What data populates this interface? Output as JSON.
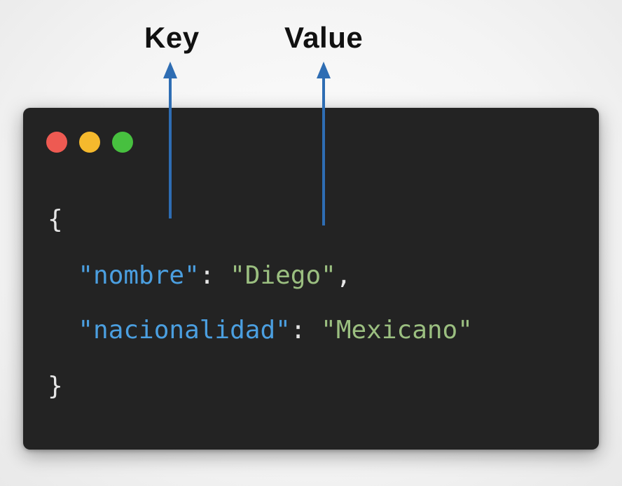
{
  "labels": {
    "key": "Key",
    "value": "Value"
  },
  "window_controls": [
    {
      "name": "close",
      "color": "#ee5a52"
    },
    {
      "name": "minimize",
      "color": "#f5b92d"
    },
    {
      "name": "zoom",
      "color": "#47c03f"
    }
  ],
  "colors": {
    "key_string": "#4b9fe0",
    "value_string": "#9bbf80",
    "punctuation": "#e6e6e6",
    "arrow": "#2e6db3",
    "window_bg": "#232323"
  },
  "code": {
    "open_brace": "{",
    "close_brace": "}",
    "entries": [
      {
        "key": "\"nombre\"",
        "colon": ": ",
        "value": "\"Diego\"",
        "trailing": ","
      },
      {
        "key": "\"nacionalidad\"",
        "colon": ": ",
        "value": "\"Mexicano\"",
        "trailing": ""
      }
    ]
  }
}
